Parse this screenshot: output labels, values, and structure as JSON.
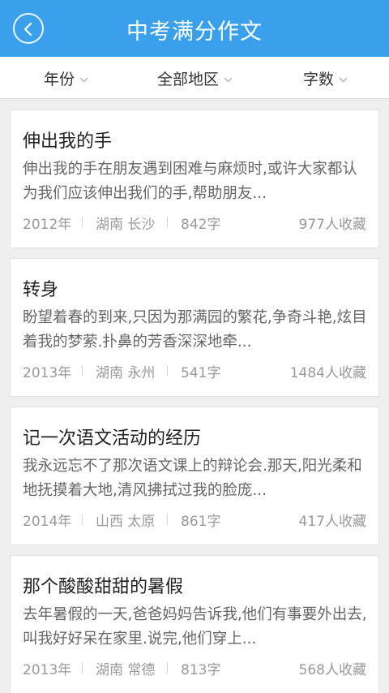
{
  "header": {
    "title": "中考满分作文"
  },
  "filters": [
    {
      "label": "年份"
    },
    {
      "label": "全部地区"
    },
    {
      "label": "字数"
    }
  ],
  "articles": [
    {
      "title": "伸出我的手",
      "excerpt": "伸出我的手在朋友遇到困难与麻烦时,或许大家都认为我们应该伸出我们的手,帮助朋友...",
      "year": "2012年",
      "region": "湖南 长沙",
      "words": "842字",
      "favorites": "977人收藏"
    },
    {
      "title": "转身",
      "excerpt": "盼望着春的到来,只因为那满园的繁花,争奇斗艳,炫目着我的梦萦.扑鼻的芳香深深地牵...",
      "year": "2013年",
      "region": "湖南 永州",
      "words": "541字",
      "favorites": "1484人收藏"
    },
    {
      "title": "记一次语文活动的经历",
      "excerpt": "我永远忘不了那次语文课上的辩论会.那天,阳光柔和地抚摸着大地,清风拂拭过我的脸庞...",
      "year": "2014年",
      "region": "山西 太原",
      "words": "861字",
      "favorites": "417人收藏"
    },
    {
      "title": "那个酸酸甜甜的暑假",
      "excerpt": "去年暑假的一天,爸爸妈妈告诉我,他们有事要外出去,叫我好好呆在家里.说完,他们穿上...",
      "year": "2013年",
      "region": "湖南 常德",
      "words": "813字",
      "favorites": "568人收藏"
    }
  ]
}
